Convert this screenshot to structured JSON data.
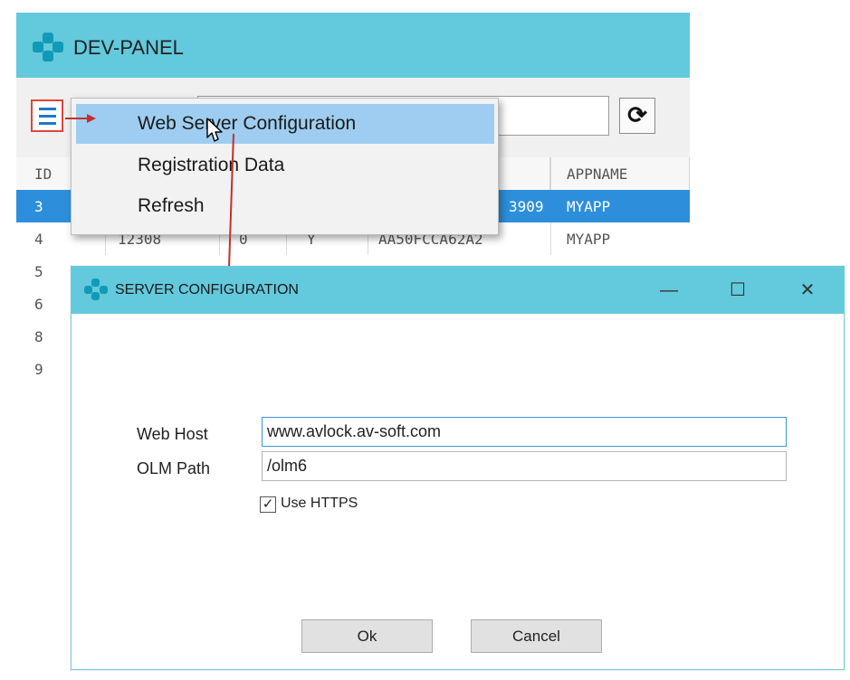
{
  "main_window": {
    "title": "DEV-PANEL",
    "refresh_icon": "refresh-arrows-icon",
    "grid": {
      "headers": {
        "id": "ID",
        "appname": "APPNAME"
      },
      "rows": [
        {
          "id": "3",
          "c1": "",
          "c2": "",
          "c3": "",
          "c4": "3909",
          "appname": "MYAPP",
          "selected": true
        },
        {
          "id": "4",
          "c1": "12308",
          "c2": "0",
          "c3": "Y",
          "c4": "AA50FCCA62A2",
          "appname": "MYAPP",
          "selected": false
        },
        {
          "id": "5"
        },
        {
          "id": "6"
        },
        {
          "id": "8"
        },
        {
          "id": "9"
        }
      ]
    }
  },
  "context_menu": {
    "items": [
      "Web Server Configuration",
      "Registration Data",
      "Refresh"
    ]
  },
  "dialog": {
    "title": "SERVER CONFIGURATION",
    "controls": {
      "minimize": "—",
      "maximize": "☐",
      "close": "✕"
    },
    "web_host_label": "Web Host",
    "web_host_value": "www.avlock.av-soft.com",
    "olm_path_label": "OLM Path",
    "olm_path_value": "/olm6",
    "use_https_label": "Use HTTPS",
    "use_https_checked": true,
    "ok_label": "Ok",
    "cancel_label": "Cancel"
  },
  "colors": {
    "titlebar": "#63c9dc",
    "selection": "#2d8fdb",
    "menu_hover": "#9ecdf1",
    "annotation": "#e0463b"
  }
}
